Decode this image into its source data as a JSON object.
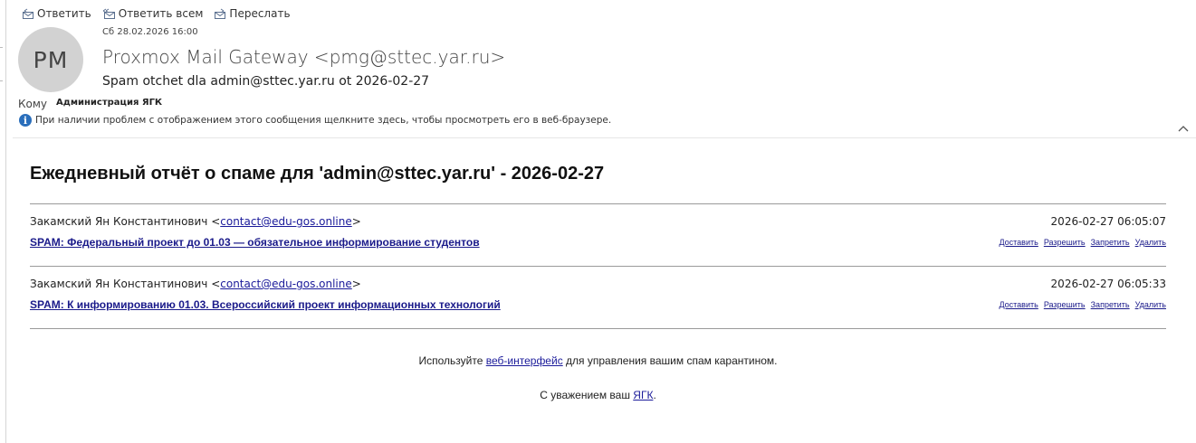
{
  "toolbar": {
    "reply": "Ответить",
    "reply_all": "Ответить всем",
    "forward": "Переслать"
  },
  "header": {
    "avatar_initials": "PM",
    "date": "Сб 28.02.2026 16:00",
    "sender": "Proxmox Mail Gateway <pmg@sttec.yar.ru>",
    "subject": "Spam otchet dla admin@sttec.yar.ru ot 2026-02-27",
    "to_label": "Кому",
    "to_value": "Администрация ЯГК",
    "info_text": "При наличии проблем с отображением этого сообщения щелкните здесь, чтобы просмотреть его в веб-браузере."
  },
  "report": {
    "title": "Ежедневный отчёт о спаме для 'admin@sttec.yar.ru' - 2026-02-27",
    "messages": [
      {
        "from_name": "Закамский Ян Константинович <",
        "from_email": "contact@edu-gos.online",
        "from_close": ">",
        "date": "2026-02-27 06:05:07",
        "subject": "SPAM: Федеральный проект до 01.03  — обязательное информирование студентов"
      },
      {
        "from_name": "Закамский Ян Константинович <",
        "from_email": "contact@edu-gos.online",
        "from_close": ">",
        "date": "2026-02-27 06:05:33",
        "subject": "SPAM: К информированию 01.03.  Всероссийский проект информационных технологий"
      }
    ],
    "actions": {
      "deliver": "Доставить",
      "allow": "Разрешить",
      "block": "Запретить",
      "delete": "Удалить"
    },
    "footer": {
      "use_prefix": "Используйте ",
      "web_link": "веб-интерфейс",
      "use_suffix": " для управления вашим спам карантином.",
      "regards_prefix": "С уважением ваш ",
      "org_link": "ЯГК",
      "regards_suffix": "."
    }
  },
  "colors": {
    "link": "#1a1a9a",
    "info_icon": "#2a6ebb",
    "avatar_bg": "#d2d2d2"
  }
}
